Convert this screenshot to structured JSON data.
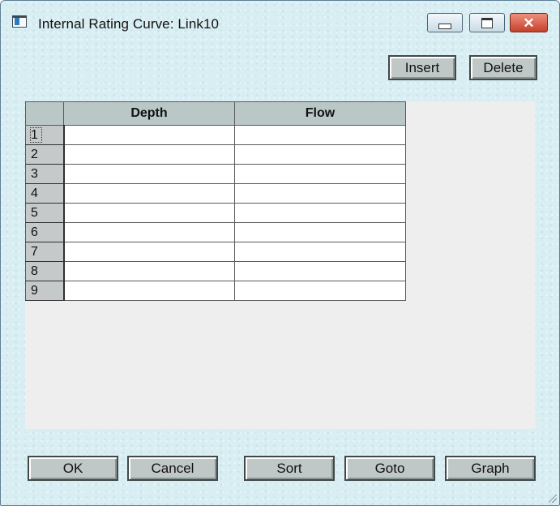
{
  "window": {
    "title": "Internal Rating Curve: Link10",
    "controls": {
      "minimize": "minimize",
      "maximize": "maximize",
      "close": "✕"
    }
  },
  "toolbar": {
    "insert_label": "Insert",
    "delete_label": "Delete"
  },
  "table": {
    "columns": [
      "Depth",
      "Flow"
    ],
    "rows": [
      {
        "num": "1",
        "depth": "",
        "flow": ""
      },
      {
        "num": "2",
        "depth": "",
        "flow": ""
      },
      {
        "num": "3",
        "depth": "",
        "flow": ""
      },
      {
        "num": "4",
        "depth": "",
        "flow": ""
      },
      {
        "num": "5",
        "depth": "",
        "flow": ""
      },
      {
        "num": "6",
        "depth": "",
        "flow": ""
      },
      {
        "num": "7",
        "depth": "",
        "flow": ""
      },
      {
        "num": "8",
        "depth": "",
        "flow": ""
      },
      {
        "num": "9",
        "depth": "",
        "flow": ""
      }
    ]
  },
  "footer": {
    "ok_label": "OK",
    "cancel_label": "Cancel",
    "sort_label": "Sort",
    "goto_label": "Goto",
    "graph_label": "Graph"
  },
  "icons": {
    "app": "app-window-icon",
    "minimize": "minimize-icon",
    "maximize": "maximize-icon",
    "close": "close-icon",
    "resize": "resize-grip-icon"
  },
  "colors": {
    "window_bg": "#d8eef3",
    "button_face": "#c0c7c7",
    "header_bg": "#b9c7c7",
    "client_bg": "#eeeeee",
    "close_button": "#c4412b"
  }
}
